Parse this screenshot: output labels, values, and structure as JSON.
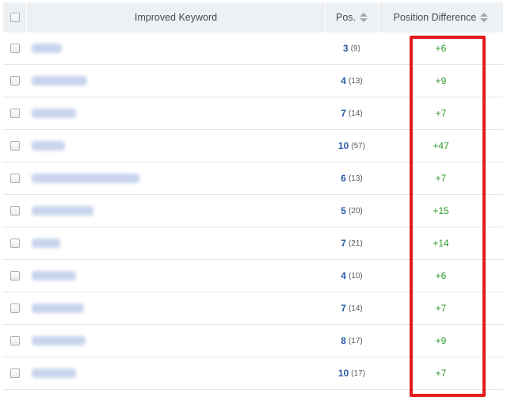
{
  "header": {
    "keyword_label": "Improved Keyword",
    "pos_label": "Pos.",
    "diff_label": "Position Difference"
  },
  "rows": [
    {
      "pos": "3",
      "prev": "(9)",
      "diff": "+6"
    },
    {
      "pos": "4",
      "prev": "(13)",
      "diff": "+9"
    },
    {
      "pos": "7",
      "prev": "(14)",
      "diff": "+7"
    },
    {
      "pos": "10",
      "prev": "(57)",
      "diff": "+47"
    },
    {
      "pos": "6",
      "prev": "(13)",
      "diff": "+7"
    },
    {
      "pos": "5",
      "prev": "(20)",
      "diff": "+15"
    },
    {
      "pos": "7",
      "prev": "(21)",
      "diff": "+14"
    },
    {
      "pos": "4",
      "prev": "(10)",
      "diff": "+6"
    },
    {
      "pos": "7",
      "prev": "(14)",
      "diff": "+7"
    },
    {
      "pos": "8",
      "prev": "(17)",
      "diff": "+9"
    },
    {
      "pos": "10",
      "prev": "(17)",
      "diff": "+7"
    }
  ],
  "colors": {
    "highlight": "#e31c1c",
    "positive": "#2e9a2e",
    "position": "#2c5aa8"
  }
}
